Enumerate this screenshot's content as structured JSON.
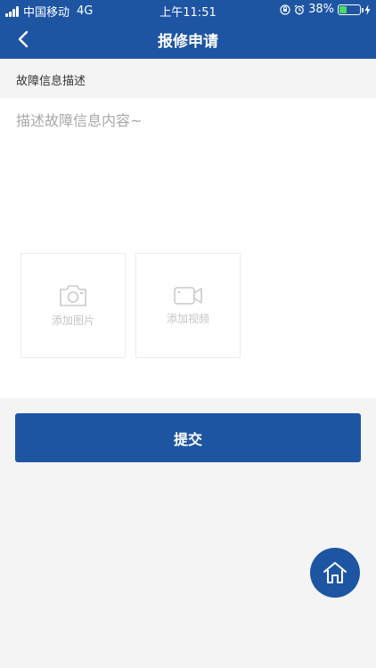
{
  "status_bar": {
    "carrier": "中国移动",
    "network": "4G",
    "time": "上午11:51",
    "battery": "38%",
    "battery_level": 0.38
  },
  "nav": {
    "title": "报修申请",
    "back_icon": "chevron-left-icon"
  },
  "form": {
    "section_label": "故障信息描述",
    "description_placeholder": "描述故障信息内容~",
    "description_value": "",
    "add_image_label": "添加图片",
    "add_video_label": "添加视频"
  },
  "actions": {
    "submit_label": "提交"
  },
  "colors": {
    "primary": "#1d55a3",
    "background": "#f4f4f4",
    "battery": "#4cd964"
  },
  "icons": [
    "camera-icon",
    "video-camera-icon",
    "home-icon"
  ]
}
